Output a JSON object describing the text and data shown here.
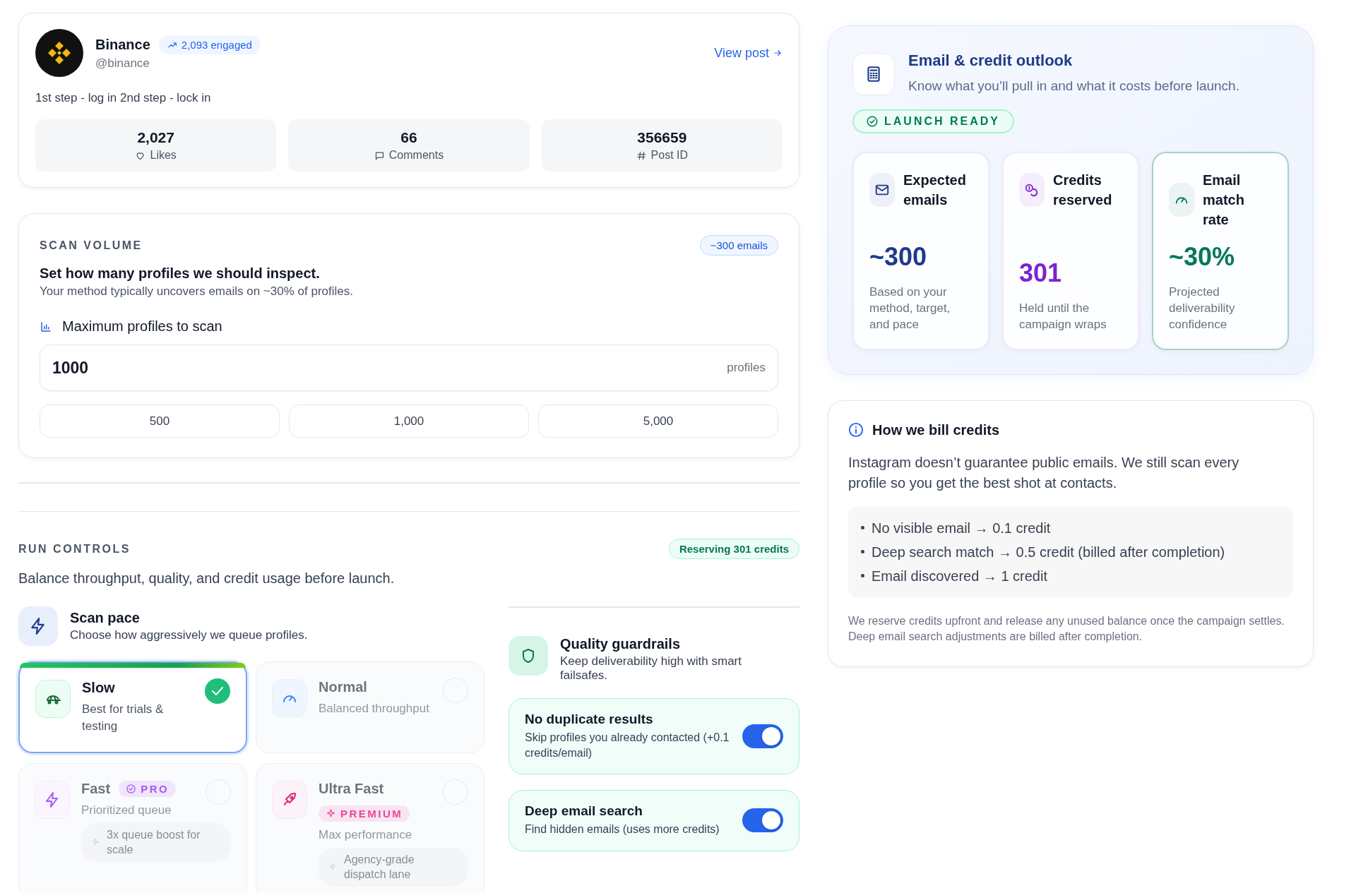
{
  "post": {
    "name": "Binance",
    "engaged": "2,093 engaged",
    "handle": "@binance",
    "link": "View post",
    "caption": "1st step - log in 2nd step - lock in",
    "stats": [
      {
        "value": "2,027",
        "label": "Likes"
      },
      {
        "value": "66",
        "label": "Comments"
      },
      {
        "value": "356659",
        "label": "Post ID"
      }
    ]
  },
  "scan_volume": {
    "heading": "SCAN VOLUME",
    "badge": "~300 emails",
    "title": "Set how many profiles we should inspect.",
    "subtitle": "Your method typically uncovers emails on ~30% of profiles.",
    "field_label": "Maximum profiles to scan",
    "field": {
      "value": "1000",
      "suffix": "profiles"
    },
    "presets": [
      "500",
      "1,000",
      "5,000"
    ]
  },
  "run_controls": {
    "heading": "RUN CONTROLS",
    "badge": "Reserving 301 credits",
    "subtitle": "Balance throughput, quality, and credit usage before launch.",
    "scan_pace": {
      "title": "Scan pace",
      "subtitle": "Choose how aggressively we queue profiles.",
      "options": [
        {
          "name": "Slow",
          "description": "Best for trials & testing",
          "selected": true
        },
        {
          "name": "Normal",
          "description": "Balanced throughput",
          "selected": false
        },
        {
          "name": "Fast",
          "description": "Prioritized queue",
          "selected": false,
          "tag": {
            "label": "PRO",
            "color": "#a855f7"
          },
          "note": "3x queue boost for scale"
        },
        {
          "name": "Ultra Fast",
          "description": "Max performance",
          "selected": false,
          "tag": {
            "label": "PREMIUM",
            "color": "#ec4899"
          },
          "note": "Agency-grade dispatch lane"
        }
      ]
    },
    "quality": {
      "title": "Quality guardrails",
      "subtitle": "Keep deliverability high with smart failsafes.",
      "toggles": [
        {
          "title": "No duplicate results",
          "description": "Skip profiles you already contacted (+0.1 credits/email)",
          "on": true
        },
        {
          "title": "Deep email search",
          "description": "Find hidden emails (uses more credits)",
          "on": true
        }
      ]
    }
  },
  "outlook": {
    "title": "Email & credit outlook",
    "subtitle": "Know what you’ll pull in and what it costs before launch.",
    "status": "LAUNCH READY",
    "metrics": [
      {
        "label": "Expected emails",
        "value": "~300",
        "note": "Based on your method, target, and pace",
        "color": "#1e3a8a"
      },
      {
        "label": "Credits reserved",
        "value": "301",
        "note": "Held until the campaign wraps",
        "color": "#7e22ce"
      },
      {
        "label": "Email match rate",
        "value": "~30%",
        "note": "Projected deliverability confidence",
        "color": "#047857"
      }
    ]
  },
  "billing": {
    "title": "How we bill credits",
    "intro": "Instagram doesn’t guarantee public emails. We still scan every profile so you get the best shot at contacts.",
    "items": [
      "No visible email → 0.1 credit",
      "Deep search match → 0.5 credit (billed after completion)",
      "Email discovered → 1 credit"
    ],
    "footnote": "We reserve credits upfront and release any unused balance once the campaign settles. Deep email search adjustments are billed after completion."
  }
}
